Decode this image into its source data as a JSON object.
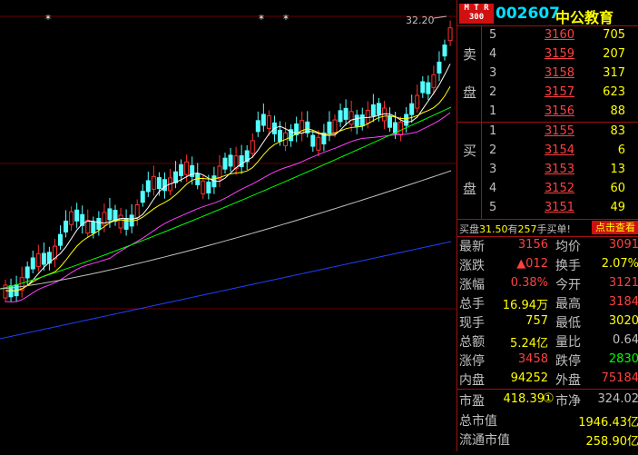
{
  "header": {
    "badge_line1": "M T R",
    "badge_line2": "300",
    "code": "002607",
    "name": "中公教育"
  },
  "chart": {
    "high_label": "32.20",
    "colors": {
      "up": "#ff3030",
      "down": "#54ffff",
      "ma5": "#ffffff",
      "ma10": "#ffff00",
      "ma20": "#ff40ff",
      "ma60": "#00ff00",
      "ma120": "#c0c0c0",
      "ma250": "#2040ff"
    }
  },
  "order_book": {
    "sell_label_1": "卖",
    "sell_label_2": "盘",
    "buy_label_1": "买",
    "buy_label_2": "盘",
    "asks": [
      {
        "level": "5",
        "price": "3160",
        "volume": "705"
      },
      {
        "level": "4",
        "price": "3159",
        "volume": "207"
      },
      {
        "level": "3",
        "price": "3158",
        "volume": "317"
      },
      {
        "level": "2",
        "price": "3157",
        "volume": "623"
      },
      {
        "level": "1",
        "price": "3156",
        "volume": "88"
      }
    ],
    "bids": [
      {
        "level": "1",
        "price": "3155",
        "volume": "83"
      },
      {
        "level": "2",
        "price": "3154",
        "volume": "6"
      },
      {
        "level": "3",
        "price": "3153",
        "volume": "13"
      },
      {
        "level": "4",
        "price": "3152",
        "volume": "60"
      },
      {
        "level": "5",
        "price": "3151",
        "volume": "49"
      }
    ]
  },
  "trade_bar": {
    "prefix": "买盘",
    "price": "31.50",
    "mid": "有",
    "count": "257",
    "suffix": "手买单!",
    "button": "点击查看"
  },
  "quote": {
    "rows": [
      {
        "l1": "最新",
        "v1": "3156",
        "c1": "#ff4040",
        "l2": "均价",
        "v2": "3091",
        "c2": "#ff4040"
      },
      {
        "l1": "涨跌",
        "v1": "▲012",
        "c1": "#ff4040",
        "l2": "换手",
        "v2": "2.07%",
        "c2": "#ffff00"
      },
      {
        "l1": "涨幅",
        "v1": "0.38%",
        "c1": "#ff4040",
        "l2": "今开",
        "v2": "3121",
        "c2": "#ff4040"
      },
      {
        "l1": "总手",
        "v1": "16.94万",
        "c1": "#ffff00",
        "l2": "最高",
        "v2": "3184",
        "c2": "#ff4040"
      },
      {
        "l1": "现手",
        "v1": "757",
        "c1": "#ffff00",
        "l2": "最低",
        "v2": "3020",
        "c2": "#ffff00"
      },
      {
        "l1": "总额",
        "v1": "5.24亿",
        "c1": "#ffff00",
        "l2": "量比",
        "v2": "0.64",
        "c2": "#c0c0c0"
      },
      {
        "l1": "涨停",
        "v1": "3458",
        "c1": "#ff4040",
        "l2": "跌停",
        "v2": "2830",
        "c2": "#00ff00"
      },
      {
        "l1": "内盘",
        "v1": "94252",
        "c1": "#ffff00",
        "l2": "外盘",
        "v2": "75184",
        "c2": "#ff4040"
      }
    ],
    "pe_label": "市盈",
    "pe_value": "418.39",
    "pe_icon": "①",
    "pb_label": "市净",
    "pb_value": "324.02",
    "total_mv_label": "总市值",
    "total_mv_value": "1946.43亿",
    "float_mv_label": "流通市值",
    "float_mv_value": "258.90亿"
  }
}
